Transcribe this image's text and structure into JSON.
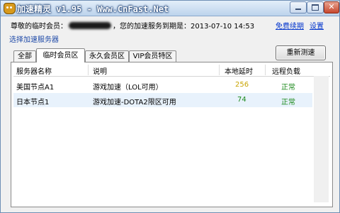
{
  "window": {
    "title": "加速精灵 v1.95 - Www.CnFast.Net",
    "controls": {
      "minimize": "",
      "maximize": "",
      "close": "✕"
    }
  },
  "member": {
    "prefix": "尊敬的临时会员：",
    "suffix": "，您的加速服务到期是：2013-07-10 14:53",
    "renew_label": "免费续期",
    "settings_label": "设置"
  },
  "section_label": "选择加速服务器",
  "tabs": [
    {
      "label": "全部"
    },
    {
      "label": "临时会员区"
    },
    {
      "label": "永久会员区"
    },
    {
      "label": "VIP会员特区"
    }
  ],
  "refresh_label": "重新测速",
  "table": {
    "columns": [
      "服务器名称",
      "说明",
      "本地延时",
      "远程负载"
    ],
    "rows": [
      {
        "name": "美国节点A1",
        "desc": "游戏加速（LOL可用）",
        "latency": "256",
        "load": "正常"
      },
      {
        "name": "日本节点1",
        "desc": "游戏加速-DOTA2限区可用",
        "latency": "74",
        "load": "正常"
      }
    ]
  },
  "colors": {
    "latency_high": "#c8a400",
    "latency_low": "#1d8a1d",
    "load_ok": "#1d8a1d",
    "link": "#0033cc"
  }
}
